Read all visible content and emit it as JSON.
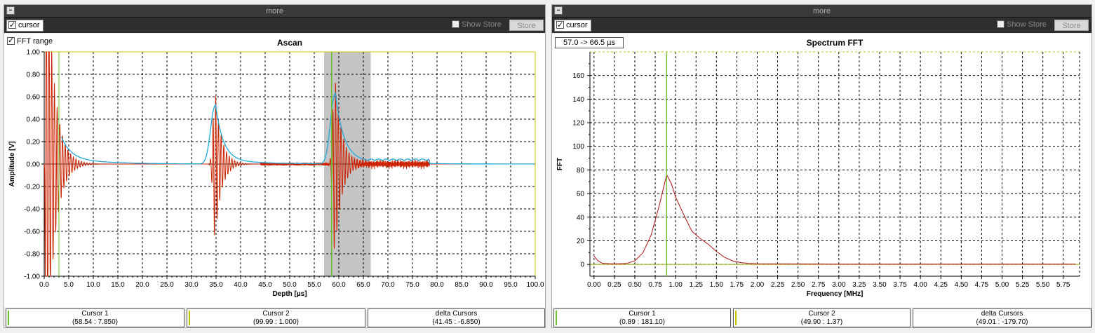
{
  "panels": [
    {
      "more_label": "more",
      "cursor_label": "cursor",
      "show_store_label": "Show Store",
      "store_label": "Store",
      "fft_range_label": "FFT range",
      "cursor_boxes": [
        {
          "label": "Cursor 1",
          "value": "(58.54 : 7.850)"
        },
        {
          "label": "Cursor 2",
          "value": "(99.99 : 1.000)"
        },
        {
          "label": "delta Cursors",
          "value": "(41.45 : -6.850)"
        }
      ]
    },
    {
      "more_label": "more",
      "cursor_label": "cursor",
      "show_store_label": "Show Store",
      "store_label": "Store",
      "range_label": "57.0 -> 66.5 µs",
      "cursor_boxes": [
        {
          "label": "Cursor 1",
          "value": "(0.89 : 181.10)"
        },
        {
          "label": "Cursor 2",
          "value": "(49.90 : 1.37)"
        },
        {
          "label": "delta Cursors",
          "value": "(49.01 : -179.70)"
        }
      ]
    }
  ],
  "colors": {
    "signal": "#cc2200",
    "envelope": "#22a8d8",
    "cursor": "#6abf2a",
    "range": "#c4c4c4",
    "fft": "#aa1111"
  },
  "chart_data": [
    {
      "type": "line",
      "title": "Ascan",
      "xlabel": "Depth [µs]",
      "ylabel": "Amplitude [V]",
      "xlim": [
        0,
        100
      ],
      "ylim": [
        -1,
        1
      ],
      "xticks": [
        "0.0",
        "5.0",
        "10.0",
        "15.0",
        "20.0",
        "25.0",
        "30.0",
        "35.0",
        "40.0",
        "45.0",
        "50.0",
        "55.0",
        "60.0",
        "65.0",
        "70.0",
        "75.0",
        "80.0",
        "85.0",
        "90.0",
        "95.0",
        "100.0"
      ],
      "yticks": [
        "1.00",
        "0.80",
        "0.60",
        "0.40",
        "0.20",
        "0.00",
        "-0.20",
        "-0.40",
        "-0.60",
        "-0.80",
        "-1.00"
      ],
      "grid": true,
      "highlight_range": [
        57.0,
        66.5
      ],
      "cursor_x": 58.54,
      "echoes": [
        {
          "t0": 0.3,
          "amp": 1.0,
          "tau": 1.6,
          "period": 0.55,
          "rise": 0.2
        },
        {
          "t0": 34.8,
          "amp": 0.52,
          "tau": 1.3,
          "period": 0.55,
          "rise": 0.9
        },
        {
          "t0": 59.2,
          "amp": 0.62,
          "tau": 1.4,
          "period": 0.55,
          "rise": 0.9
        }
      ],
      "noise_range": [
        63,
        78.5
      ]
    },
    {
      "type": "line",
      "title": "Spectrum FFT",
      "xlabel": "Frequency [MHz]",
      "ylabel": "FFT",
      "xlim": [
        -0.05,
        5.95
      ],
      "ylim": [
        -10,
        180
      ],
      "xticks": [
        "0.00",
        "0.25",
        "0.50",
        "0.75",
        "1.00",
        "1.25",
        "1.50",
        "1.75",
        "2.00",
        "2.25",
        "2.50",
        "2.75",
        "3.00",
        "3.25",
        "3.50",
        "3.75",
        "4.00",
        "4.25",
        "4.50",
        "4.75",
        "5.00",
        "5.25",
        "5.50",
        "5.75"
      ],
      "yticks": [
        "160",
        "140",
        "120",
        "100",
        "80",
        "60",
        "40",
        "20",
        "0"
      ],
      "grid": true,
      "cursor_x": 0.89,
      "series": [
        {
          "x": [
            0.0,
            0.05,
            0.1,
            0.2,
            0.3,
            0.4,
            0.5,
            0.6,
            0.7,
            0.8,
            0.89,
            0.95,
            1.0,
            1.1,
            1.2,
            1.3,
            1.4,
            1.5,
            1.6,
            1.7,
            1.8,
            1.9,
            2.0,
            2.5,
            3.0,
            4.0,
            5.0,
            5.9
          ],
          "y": [
            7,
            3,
            1,
            0.5,
            0.5,
            0.8,
            3,
            10,
            25,
            50,
            76,
            68,
            57,
            42,
            28,
            22,
            17,
            11,
            6,
            3,
            1.5,
            0.8,
            0.5,
            0.4,
            0.3,
            0.3,
            0.2,
            0.2
          ]
        }
      ]
    }
  ]
}
